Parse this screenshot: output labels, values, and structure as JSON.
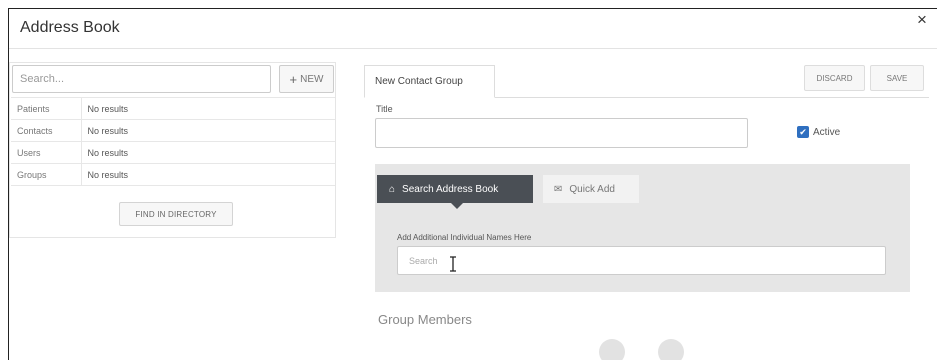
{
  "dialog": {
    "title": "Address Book",
    "close_glyph": "×"
  },
  "left_panel": {
    "search_placeholder": "Search...",
    "new_button": {
      "icon": "plus-icon",
      "glyph": "+",
      "label": "NEW"
    },
    "results": [
      {
        "category": "Patients",
        "value": "No results"
      },
      {
        "category": "Contacts",
        "value": "No results"
      },
      {
        "category": "Users",
        "value": "No results"
      },
      {
        "category": "Groups",
        "value": "No results"
      }
    ],
    "find_button": "FIND IN DIRECTORY"
  },
  "editor": {
    "tab_label": "New Contact Group",
    "discard_label": "DISCARD",
    "save_label": "SAVE",
    "title_label": "Title",
    "title_value": "",
    "active_checked": true,
    "active_label": "Active",
    "accent_color": "#2f6fc0"
  },
  "search_section": {
    "tab_search_book": {
      "icon": "home-icon",
      "glyph": "⌂",
      "label": "Search Address Book"
    },
    "tab_quick_add": {
      "icon": "envelope-icon",
      "glyph": "✉",
      "label": "Quick Add"
    },
    "add_names_label": "Add Additional Individual Names Here",
    "names_search_placeholder": "Search",
    "active_tab_color": "#4a4f55"
  },
  "group_members": {
    "label": "Group Members"
  }
}
